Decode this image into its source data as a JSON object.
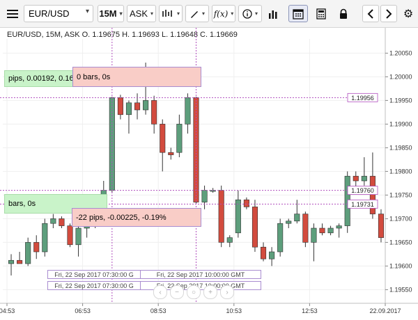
{
  "toolbar": {
    "symbol": "EUR/USD",
    "timeframe": "15M",
    "price_side": "ASK",
    "fx_label": "f(x)"
  },
  "info_line": "EUR/USD, 15M, ASK   O. 1.19675 H. 1.19693 L. 1.19648 C. 1.19669",
  "annotations": {
    "top_green": "pips, 0.00192, 0.16",
    "top_pink": "0 bars, 0s",
    "bottom_green": "bars, 0s",
    "bottom_pink": "-22 pips, -0.00225, -0.19%",
    "ts1": "Fri, 22 Sep 2017 07:30:00 G",
    "ts2": "Fri, 22 Sep 2017 10:00:00 GMT",
    "ts3": "Fri, 22 Sep 2017 07:30:00 G",
    "ts4": "Fri, 22 Sep 2017 10:00:00 GMT"
  },
  "price_markers": [
    "1.19956",
    "1.19760",
    "1.19731"
  ],
  "colors": {
    "bull": "#5d9e7c",
    "bear": "#d24b3e",
    "marker_line": "#b04dbd"
  },
  "chart_data": {
    "type": "candlestick",
    "x_ticks": [
      "04:53",
      "06:53",
      "08:53",
      "10:53",
      "12:53",
      "22.09.2017"
    ],
    "y_ticks": [
      "1.19550",
      "1.19600",
      "1.19650",
      "1.19700",
      "1.19750",
      "1.19800",
      "1.19850",
      "1.19900",
      "1.19950",
      "1.20000",
      "1.20050"
    ],
    "ylim": [
      1.1953,
      1.2008
    ],
    "candles": [
      {
        "o": 1.19605,
        "h": 1.19625,
        "l": 1.1958,
        "c": 1.19612
      },
      {
        "o": 1.19612,
        "h": 1.1963,
        "l": 1.19605,
        "c": 1.19605
      },
      {
        "o": 1.19605,
        "h": 1.1966,
        "l": 1.196,
        "c": 1.1965
      },
      {
        "o": 1.1965,
        "h": 1.19665,
        "l": 1.19615,
        "c": 1.1963
      },
      {
        "o": 1.1963,
        "h": 1.197,
        "l": 1.1962,
        "c": 1.1969
      },
      {
        "o": 1.1969,
        "h": 1.1971,
        "l": 1.1968,
        "c": 1.197
      },
      {
        "o": 1.197,
        "h": 1.19705,
        "l": 1.1968,
        "c": 1.19685
      },
      {
        "o": 1.19685,
        "h": 1.1969,
        "l": 1.1964,
        "c": 1.19645
      },
      {
        "o": 1.19645,
        "h": 1.1969,
        "l": 1.1962,
        "c": 1.1968
      },
      {
        "o": 1.1968,
        "h": 1.1972,
        "l": 1.1966,
        "c": 1.1969
      },
      {
        "o": 1.1969,
        "h": 1.1974,
        "l": 1.1968,
        "c": 1.1971
      },
      {
        "o": 1.19745,
        "h": 1.1978,
        "l": 1.1974,
        "c": 1.1976
      },
      {
        "o": 1.1976,
        "h": 1.19958,
        "l": 1.19755,
        "c": 1.19956
      },
      {
        "o": 1.19956,
        "h": 1.19962,
        "l": 1.1991,
        "c": 1.1992
      },
      {
        "o": 1.1992,
        "h": 1.1995,
        "l": 1.1988,
        "c": 1.19945
      },
      {
        "o": 1.19945,
        "h": 1.19965,
        "l": 1.1991,
        "c": 1.1993
      },
      {
        "o": 1.1993,
        "h": 1.2003,
        "l": 1.1992,
        "c": 1.1995
      },
      {
        "o": 1.1995,
        "h": 1.1996,
        "l": 1.1988,
        "c": 1.199
      },
      {
        "o": 1.199,
        "h": 1.1991,
        "l": 1.198,
        "c": 1.1984
      },
      {
        "o": 1.1984,
        "h": 1.1985,
        "l": 1.19825,
        "c": 1.19835
      },
      {
        "o": 1.1984,
        "h": 1.1992,
        "l": 1.1983,
        "c": 1.199
      },
      {
        "o": 1.199,
        "h": 1.19965,
        "l": 1.1988,
        "c": 1.19956
      },
      {
        "o": 1.19956,
        "h": 1.19958,
        "l": 1.19731,
        "c": 1.19735
      },
      {
        "o": 1.19735,
        "h": 1.1977,
        "l": 1.1972,
        "c": 1.1976
      },
      {
        "o": 1.1976,
        "h": 1.19765,
        "l": 1.19755,
        "c": 1.1976
      },
      {
        "o": 1.1976,
        "h": 1.1977,
        "l": 1.1964,
        "c": 1.1965
      },
      {
        "o": 1.1965,
        "h": 1.19665,
        "l": 1.1964,
        "c": 1.1966
      },
      {
        "o": 1.1967,
        "h": 1.1976,
        "l": 1.1966,
        "c": 1.1974
      },
      {
        "o": 1.1974,
        "h": 1.19745,
        "l": 1.1972,
        "c": 1.19725
      },
      {
        "o": 1.19725,
        "h": 1.1974,
        "l": 1.1963,
        "c": 1.1964
      },
      {
        "o": 1.1964,
        "h": 1.1965,
        "l": 1.1961,
        "c": 1.19615
      },
      {
        "o": 1.19615,
        "h": 1.1964,
        "l": 1.196,
        "c": 1.1963
      },
      {
        "o": 1.1963,
        "h": 1.197,
        "l": 1.1962,
        "c": 1.1969
      },
      {
        "o": 1.1969,
        "h": 1.197,
        "l": 1.1968,
        "c": 1.19695
      },
      {
        "o": 1.19695,
        "h": 1.1974,
        "l": 1.1969,
        "c": 1.1971
      },
      {
        "o": 1.1971,
        "h": 1.19715,
        "l": 1.1964,
        "c": 1.1965
      },
      {
        "o": 1.1965,
        "h": 1.1969,
        "l": 1.1961,
        "c": 1.1968
      },
      {
        "o": 1.1968,
        "h": 1.1969,
        "l": 1.19665,
        "c": 1.1967
      },
      {
        "o": 1.1967,
        "h": 1.19685,
        "l": 1.19665,
        "c": 1.1968
      },
      {
        "o": 1.1968,
        "h": 1.1969,
        "l": 1.1966,
        "c": 1.19685
      },
      {
        "o": 1.19685,
        "h": 1.198,
        "l": 1.1967,
        "c": 1.1979
      },
      {
        "o": 1.1979,
        "h": 1.198,
        "l": 1.1976,
        "c": 1.1978
      },
      {
        "o": 1.1978,
        "h": 1.1983,
        "l": 1.1977,
        "c": 1.1979
      },
      {
        "o": 1.1979,
        "h": 1.1984,
        "l": 1.197,
        "c": 1.1971
      },
      {
        "o": 1.1971,
        "h": 1.1972,
        "l": 1.1965,
        "c": 1.1966
      }
    ]
  }
}
